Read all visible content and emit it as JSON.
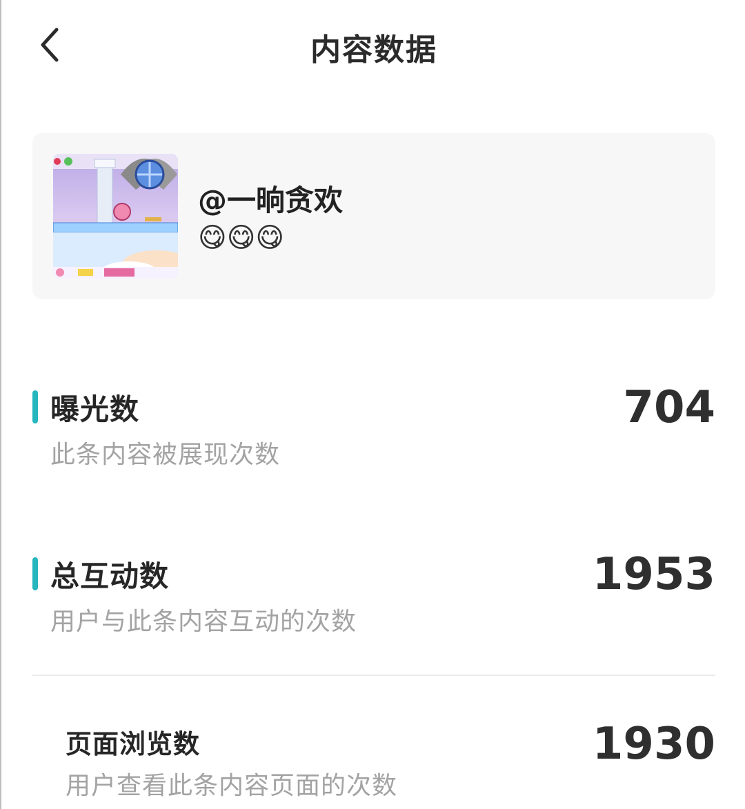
{
  "header": {
    "title": "内容数据",
    "back_icon": "chevron-left-icon"
  },
  "content_card": {
    "author": "@一晌贪欢",
    "caption": "😋😋😋",
    "thumbnail": "game-screenshot-thumbnail"
  },
  "metrics": [
    {
      "label": "曝光数",
      "description": "此条内容被展现次数",
      "value": "704"
    },
    {
      "label": "总互动数",
      "description": "用户与此条内容互动的次数",
      "value": "1953"
    }
  ],
  "sub_metrics": [
    {
      "label": "页面浏览数",
      "description": "用户查看此条内容页面的次数",
      "value": "1930"
    }
  ],
  "colors": {
    "accent_bar": "#26b6be",
    "card_bg": "#f7f7f7",
    "desc_text": "#a3a3a3"
  }
}
